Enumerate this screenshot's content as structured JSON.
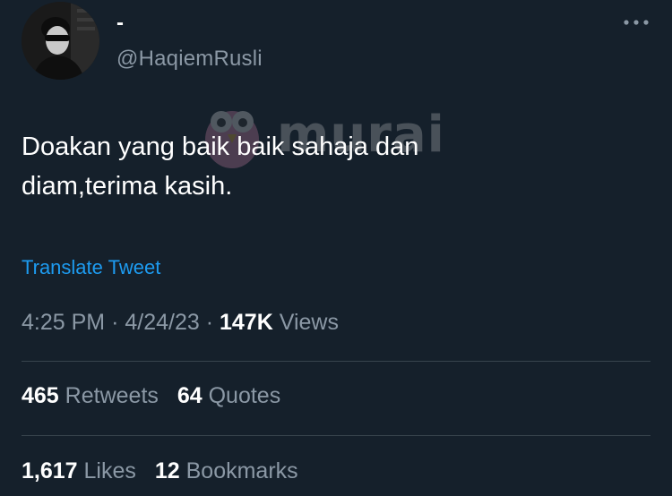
{
  "author": {
    "display_name": "-",
    "handle": "@HaqiemRusli"
  },
  "icons": {
    "more": "more-horizontal-icon",
    "avatar": "avatar"
  },
  "watermark": {
    "text": "murai"
  },
  "tweet": {
    "text": "Doakan yang baik baik sahaja dan\ndiam,terima kasih.",
    "translate_label": "Translate Tweet"
  },
  "meta": {
    "time": "4:25 PM",
    "separator1": "·",
    "date": "4/24/23",
    "separator2": "·",
    "views_count": "147K",
    "views_label": "Views"
  },
  "stats": {
    "retweets_count": "465",
    "retweets_label": "Retweets",
    "quotes_count": "64",
    "quotes_label": "Quotes",
    "likes_count": "1,617",
    "likes_label": "Likes",
    "bookmarks_count": "12",
    "bookmarks_label": "Bookmarks"
  },
  "colors": {
    "background": "#15202b",
    "primary_text": "#ffffff",
    "secondary_text": "#8b98a5",
    "link": "#1d9bf0",
    "divider": "#38444d"
  }
}
